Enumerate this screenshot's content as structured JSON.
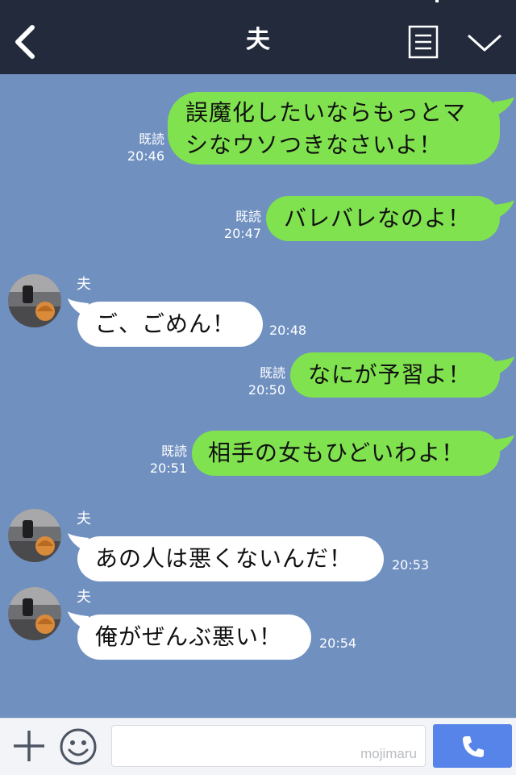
{
  "header": {
    "title": "夫"
  },
  "messages": [
    {
      "dir": "out",
      "lines": [
        "誤魔化したいならもっとマ",
        "シなウソつきなさいよ！"
      ],
      "read": "既読",
      "time": "20:46"
    },
    {
      "dir": "out",
      "lines": [
        "バレバレなのよ！"
      ],
      "read": "既読",
      "time": "20:47"
    },
    {
      "dir": "in",
      "sender": "夫",
      "lines": [
        "ご、ごめん！"
      ],
      "time": "20:48"
    },
    {
      "dir": "out",
      "lines": [
        "なにが予習よ！"
      ],
      "read": "既読",
      "time": "20:50"
    },
    {
      "dir": "out",
      "lines": [
        "相手の女もひどいわよ！"
      ],
      "read": "既読",
      "time": "20:51"
    },
    {
      "dir": "in",
      "sender": "夫",
      "lines": [
        "あの人は悪くないんだ！"
      ],
      "time": "20:53"
    },
    {
      "dir": "in",
      "sender": "夫",
      "lines": [
        "俺がぜんぶ悪い！"
      ],
      "time": "20:54"
    }
  ],
  "footer": {
    "input_value": "",
    "watermark": "mojimaru"
  },
  "icons": {
    "back": "back-chevron-icon",
    "menu": "note-menu-icon",
    "collapse": "chevron-down-icon",
    "plus": "plus-icon",
    "emoji": "smiley-icon",
    "call": "phone-icon"
  },
  "colors": {
    "header_bg": "#222a3c",
    "chat_bg": "#7090c0",
    "outgoing_bubble": "#80e24e",
    "incoming_bubble": "#ffffff",
    "call_button": "#5784e8"
  }
}
